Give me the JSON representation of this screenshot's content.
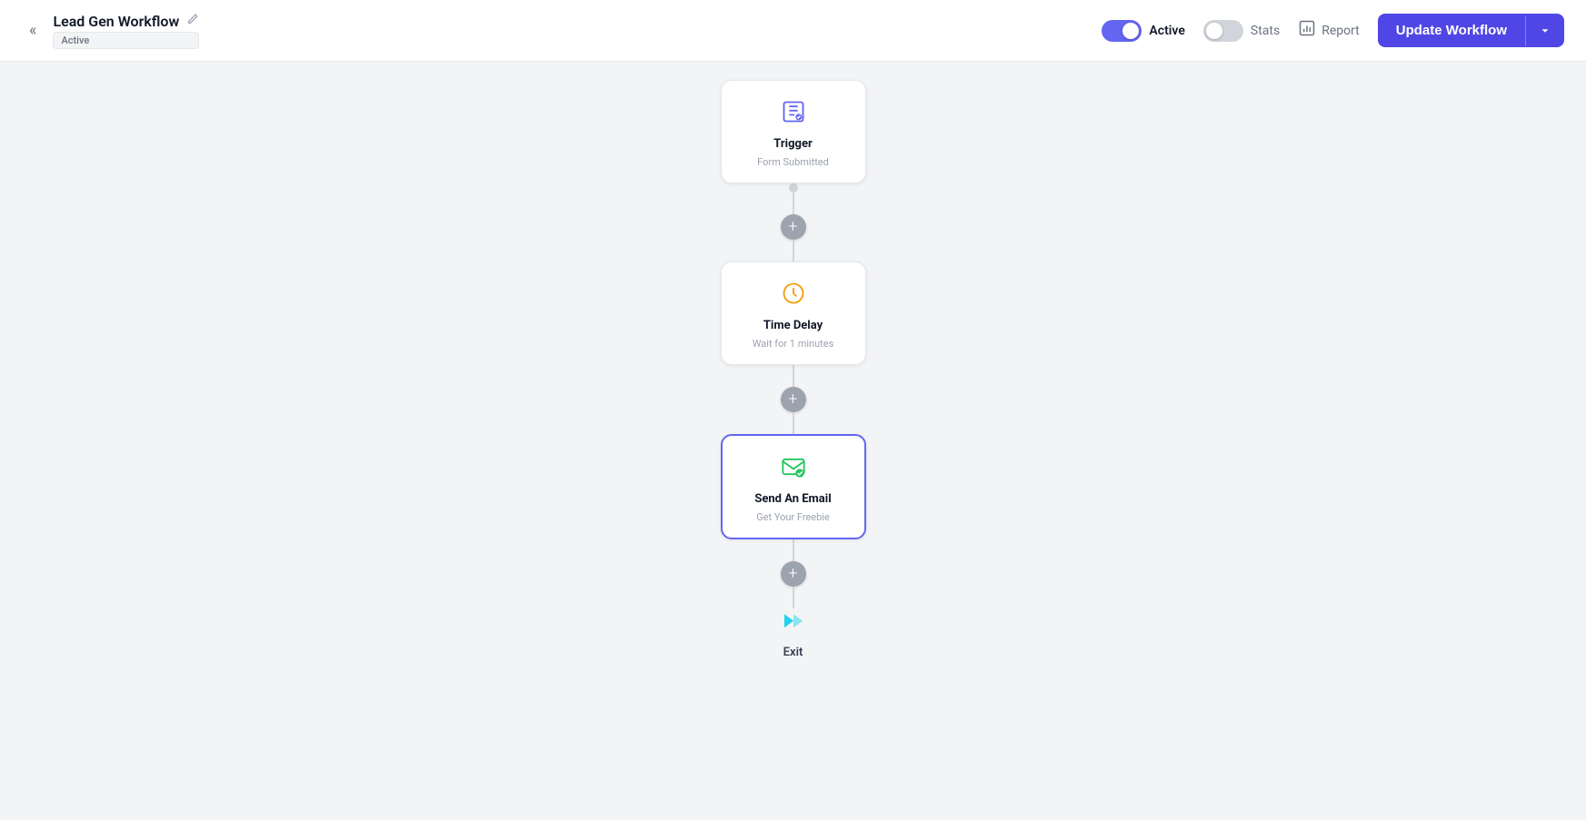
{
  "header": {
    "back_label": "«",
    "title": "Lead Gen Workflow",
    "edit_icon": "✏",
    "status": "Active",
    "active_toggle": true,
    "active_label": "Active",
    "stats_label": "Stats",
    "report_label": "Report",
    "update_btn_label": "Update Workflow",
    "update_btn_arrow": "▾"
  },
  "workflow": {
    "nodes": [
      {
        "id": "trigger",
        "icon": "📋",
        "title": "Trigger",
        "subtitle": "Form Submitted",
        "selected": false
      },
      {
        "id": "time-delay",
        "icon": "🕐",
        "title": "Time Delay",
        "subtitle": "Wait for 1 minutes",
        "selected": false
      },
      {
        "id": "send-email",
        "icon": "✉",
        "title": "Send An Email",
        "subtitle": "Get Your Freebie",
        "selected": true
      }
    ],
    "exit": {
      "icon": "🚩",
      "label": "Exit"
    }
  }
}
